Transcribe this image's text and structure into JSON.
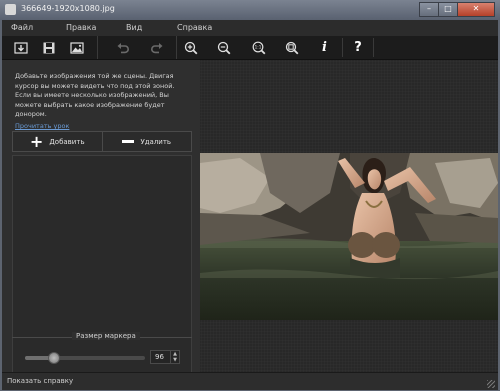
{
  "window": {
    "title": "366649-1920x1080.jpg",
    "controls": {
      "minimize": "–",
      "maximize": "□",
      "close": "✕"
    }
  },
  "menu": [
    {
      "label": "Файл"
    },
    {
      "label": "Правка"
    },
    {
      "label": "Вид"
    },
    {
      "label": "Справка"
    }
  ],
  "toolbar": {
    "tools": [
      "open-icon",
      "save-icon",
      "image-icon",
      "undo-icon",
      "redo-icon",
      "zoom-in-icon",
      "zoom-out-icon",
      "actual-size-icon",
      "fit-window-icon",
      "info-icon",
      "help-icon"
    ],
    "help_label": "?",
    "info_label": "i",
    "actual_size_label": "1:1"
  },
  "left_panel": {
    "instructions": "Добавьте изображения той же сцены. Двигая курсор вы можете видеть что под этой зоной. Если вы имеете несколько изображений, Вы можете выбрать какое изображение будет донором.",
    "tutorial_link": "Прочитать урок",
    "add_button": "Добавить",
    "remove_button": "Удалить",
    "marker": {
      "label": "Размер маркера",
      "value": "96",
      "level": 0.23
    }
  },
  "status_bar": {
    "text": "Показать справку"
  },
  "colors": {
    "background": "#232323",
    "panel": "#2f2f2f",
    "link": "#6a9ad4",
    "title_bar": "#6b7380"
  }
}
